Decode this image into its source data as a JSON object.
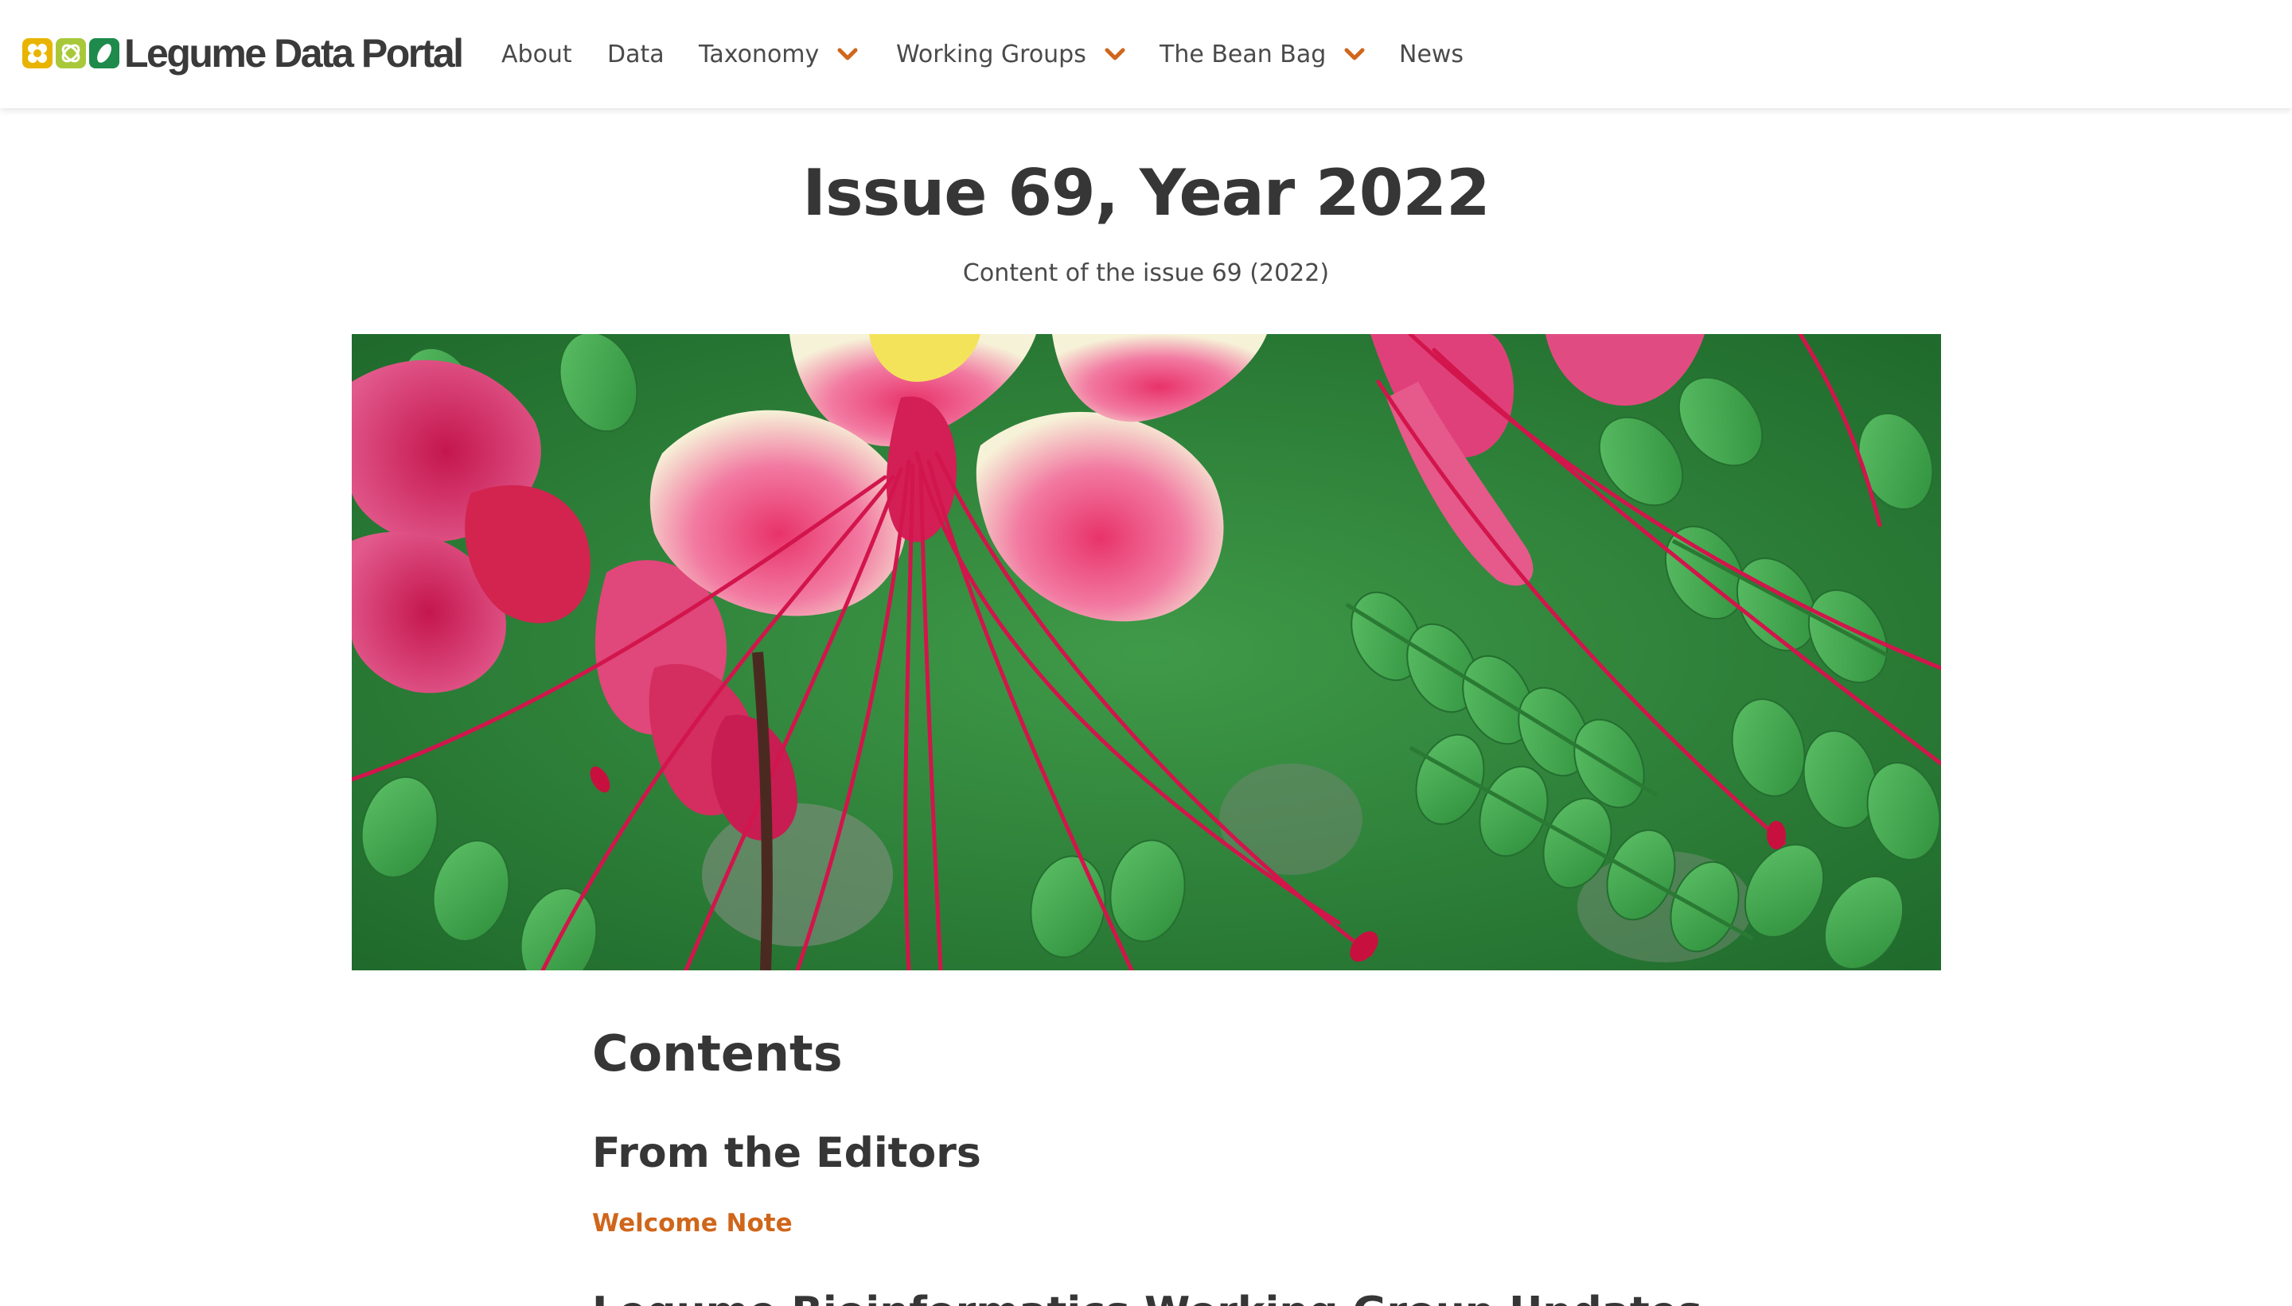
{
  "colors": {
    "accent": "#d0661b",
    "heading": "#363636",
    "nav_text": "#4a4a4a",
    "logo_yellow": "#e8b400",
    "logo_lime": "#a8c83a",
    "logo_green": "#1e8a4c"
  },
  "header": {
    "brand_name": "Legume Data Portal",
    "nav": [
      {
        "label": "About",
        "has_dropdown": false
      },
      {
        "label": "Data",
        "has_dropdown": false
      },
      {
        "label": "Taxonomy",
        "has_dropdown": true
      },
      {
        "label": "Working Groups",
        "has_dropdown": true
      },
      {
        "label": "The Bean Bag",
        "has_dropdown": true
      },
      {
        "label": "News",
        "has_dropdown": false
      }
    ],
    "dropdown_icon": "chevron-down-icon"
  },
  "page": {
    "title": "Issue 69, Year 2022",
    "subtitle": "Content of the issue 69 (2022)"
  },
  "contents": {
    "heading": "Contents",
    "sections": [
      {
        "heading": "From the Editors",
        "links": [
          "Welcome Note"
        ]
      }
    ],
    "next_section_partial": "Legume Bioinformatics Working Group Updates"
  }
}
